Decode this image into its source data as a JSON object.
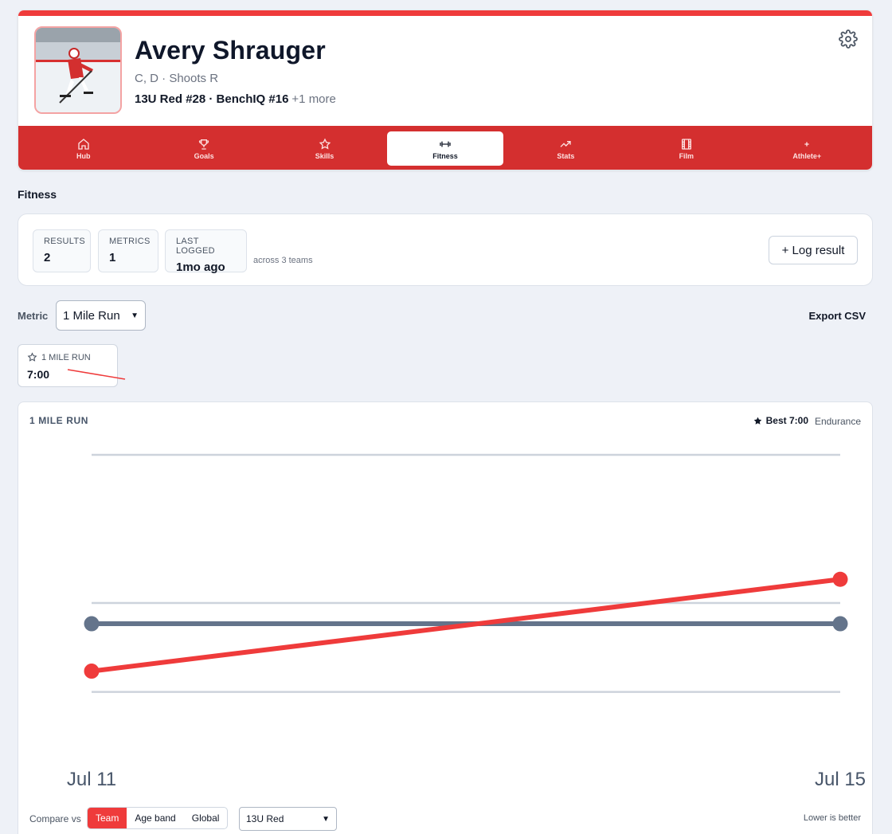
{
  "profile": {
    "name": "Avery Shrauger",
    "positions": "C, D · Shoots R",
    "teams": "13U Red #28 · BenchIQ #16",
    "teams_more": "+1 more"
  },
  "tabs": [
    {
      "label": "Hub",
      "icon": "home-icon"
    },
    {
      "label": "Goals",
      "icon": "trophy-icon"
    },
    {
      "label": "Skills",
      "icon": "star-icon"
    },
    {
      "label": "Fitness",
      "icon": "dumbbell-icon",
      "active": true
    },
    {
      "label": "Stats",
      "icon": "trending-up-icon"
    },
    {
      "label": "Film",
      "icon": "film-icon"
    },
    {
      "label": "Athlete+",
      "icon": "plus-icon"
    }
  ],
  "section_title": "Fitness",
  "summary": {
    "results_label": "RESULTS",
    "results_value": "2",
    "metrics_label": "METRICS",
    "metrics_value": "1",
    "last_label": "LAST LOGGED",
    "last_value": "1mo ago",
    "across": "across 3 teams",
    "log_button": "+ Log result"
  },
  "metric_picker": {
    "label": "Metric",
    "selected": "1 Mile Run"
  },
  "export_label": "Export CSV",
  "mini_card": {
    "label": "1 MILE RUN",
    "value": "7:00"
  },
  "chart_header": {
    "title": "1 MILE RUN",
    "best": "Best 7:00",
    "category": "Endurance"
  },
  "compare": {
    "label": "Compare vs",
    "options": [
      "Team",
      "Age band",
      "Global"
    ],
    "active": "Team",
    "team_selected": "13U Red",
    "note": "Lower is better"
  },
  "colors": {
    "accent": "#ef3b3b",
    "tabbar": "#d42f2f",
    "comparison": "#64748b"
  },
  "chart_data": {
    "type": "line",
    "x": [
      "Jul 11",
      "Jul 15"
    ],
    "series": [
      {
        "values": [
          0.73,
          0.42
        ],
        "color": "#ef3b3b"
      },
      {
        "values": [
          0.57,
          0.57
        ],
        "color": "#64748b"
      }
    ],
    "ylim": [
      0,
      1
    ],
    "yreverse": true,
    "gridlines": [
      0.0,
      0.5,
      0.8
    ],
    "tick_labels": [
      "Jul 11",
      "Jul 15"
    ],
    "grid": true
  }
}
